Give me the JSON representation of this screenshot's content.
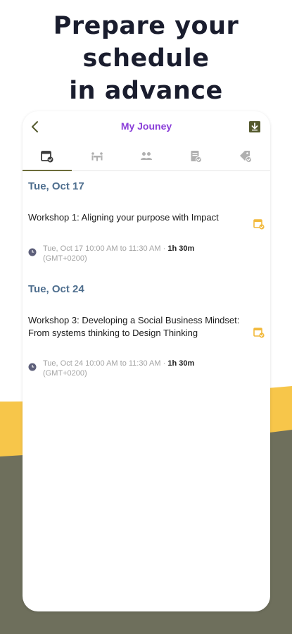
{
  "headline": [
    "Prepare your",
    "schedule",
    "in advance"
  ],
  "app_title": "My Jouney",
  "tabs": [
    {
      "icon": "calendar-check-icon",
      "active": true
    },
    {
      "icon": "meeting-table-icon",
      "active": false
    },
    {
      "icon": "people-group-icon",
      "active": false
    },
    {
      "icon": "document-check-icon",
      "active": false
    },
    {
      "icon": "tag-check-icon",
      "active": false
    }
  ],
  "days": [
    {
      "date": "Tue, Oct 17",
      "sessions": [
        {
          "title": "Workshop 1: Aligning your purpose with Impact",
          "time": "Tue, Oct 17 10:00 AM to 11:30 AM · ",
          "duration": "1h 30m",
          "timezone": "(GMT+0200)"
        }
      ]
    },
    {
      "date": "Tue, Oct 24",
      "sessions": [
        {
          "title": "Workshop 3: Developing a Social Business Mindset: From systems thinking to Design Thinking",
          "time": "Tue, Oct 24 10:00 AM to 11:30 AM · ",
          "duration": "1h 30m",
          "timezone": "(GMT+0200)"
        }
      ]
    }
  ],
  "colors": {
    "accent_purple": "#8b3fd9",
    "date_blue": "#4e6e8e",
    "wave_yellow": "#f7c64a",
    "wave_olive": "#6e6f5c",
    "session_icon_yellow": "#f2b93b"
  }
}
